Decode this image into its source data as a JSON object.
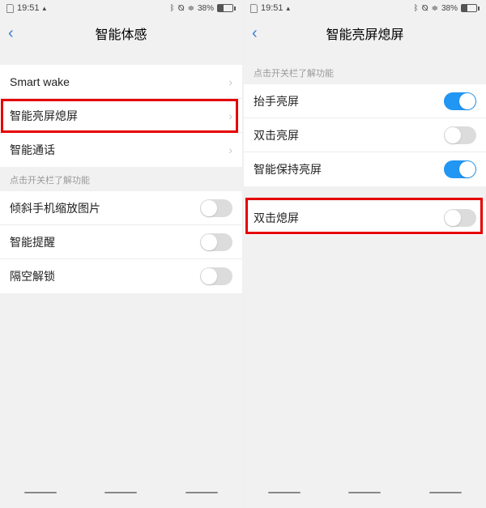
{
  "status": {
    "time": "19:51",
    "battery_pct": "38%"
  },
  "left": {
    "title": "智能体感",
    "rows_nav": [
      {
        "label": "Smart wake"
      },
      {
        "label": "智能亮屏熄屏"
      },
      {
        "label": "智能通话"
      }
    ],
    "section_label": "点击开关栏了解功能",
    "rows_toggle": [
      {
        "label": "倾斜手机缩放图片",
        "on": false
      },
      {
        "label": "智能提醒",
        "on": false
      },
      {
        "label": "隔空解锁",
        "on": false
      }
    ]
  },
  "right": {
    "title": "智能亮屏熄屏",
    "section_label": "点击开关栏了解功能",
    "rows_toggle_a": [
      {
        "label": "抬手亮屏",
        "on": true
      },
      {
        "label": "双击亮屏",
        "on": false
      },
      {
        "label": "智能保持亮屏",
        "on": true
      }
    ],
    "rows_toggle_b": [
      {
        "label": "双击熄屏",
        "on": false
      }
    ]
  }
}
